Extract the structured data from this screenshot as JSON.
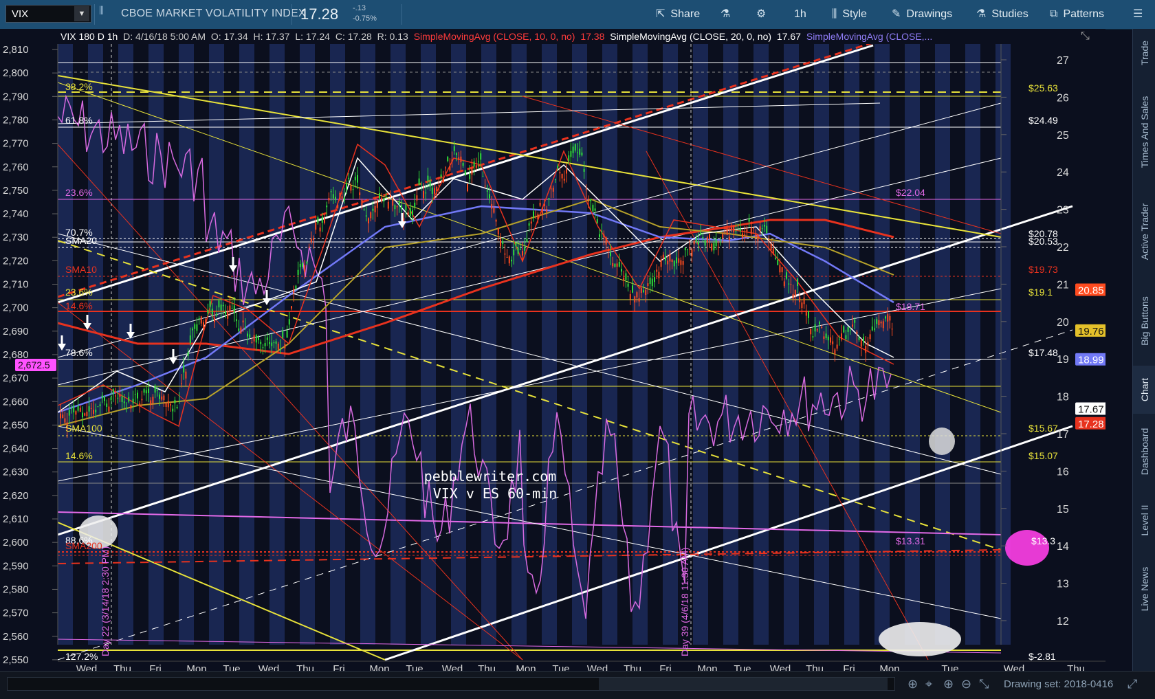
{
  "topbar": {
    "symbol": "VIX",
    "description": "CBOE MARKET VOLATILITY INDEX",
    "price": "17.28",
    "change": "-.13",
    "change_pct": "-0.75%",
    "share": "Share",
    "timeframe": "1h",
    "style": "Style",
    "drawings": "Drawings",
    "studies": "Studies",
    "patterns": "Patterns"
  },
  "info": {
    "symbol": "VIX 180 D 1h",
    "date": "D: 4/16/18 5:00 AM",
    "open": "O: 17.34",
    "high": "H: 17.37",
    "low": "L: 17.24",
    "close": "C: 17.28",
    "range": "R: 0.13",
    "sma10": "SimpleMovingAvg (CLOSE, 10, 0, no)",
    "sma10_val": "17.38",
    "sma20": "SimpleMovingAvg (CLOSE, 20, 0, no)",
    "sma20_val": "17.67",
    "sma_more": "SimpleMovingAvg (CLOSE,..."
  },
  "left_axis": [
    "2,810",
    "2,800",
    "2,790",
    "2,780",
    "2,770",
    "2,760",
    "2,750",
    "2,740",
    "2,730",
    "2,720",
    "2,710",
    "2,700",
    "2,690",
    "2,680",
    "2,670",
    "2,660",
    "2,650",
    "2,640",
    "2,630",
    "2,620",
    "2,610",
    "2,600",
    "2,590",
    "2,580",
    "2,570",
    "2,560",
    "2,550"
  ],
  "left_marker": "2,672.5",
  "right_axis": [
    "27",
    "26",
    "25",
    "24",
    "23",
    "22",
    "21",
    "20",
    "19",
    "18",
    "17",
    "16",
    "15",
    "14",
    "13",
    "12"
  ],
  "right_markers": {
    "sma10": "20.85",
    "sma50": "19.76",
    "sma100": "18.99",
    "sma20": "17.67",
    "last": "17.28"
  },
  "x_axis": [
    "Wed",
    "Thu",
    "Fri",
    "Mon",
    "Tue",
    "Wed",
    "Thu",
    "Fri",
    "Mon",
    "Tue",
    "Wed",
    "Thu",
    "Mon",
    "Tue",
    "Wed",
    "Thu",
    "Fri",
    "Mon",
    "Tue",
    "Wed",
    "Thu",
    "Fri",
    "Mon",
    "Tue",
    "Wed",
    "Thu"
  ],
  "fib_labels_left": [
    "38.2%",
    "61.8%",
    "23.6%",
    "70.7%",
    "SMA20",
    "SMA10",
    "23.6%",
    "14.6%",
    "78.6%",
    "SMA100",
    "14.6%",
    "88.6%",
    "SMA200",
    "127.2%"
  ],
  "level_labels_right": [
    "$25.63",
    "$24.49",
    "$22.04",
    "$20.78",
    "$20.53",
    "$19.73",
    "$19.1",
    "$18.71",
    "$17.48",
    "$15.67",
    "$15.07",
    "$13.31",
    "$13.3",
    "$-2.81"
  ],
  "watermark": {
    "line1": "pebblewriter.com",
    "line2": "VIX v ES 60-min"
  },
  "vertical_labels": {
    "day22": "Day 22 (3/14/18 2:30 PM)",
    "day39": "Day 39 (4/6/18 11:30 AM)"
  },
  "right_tabs": [
    "Trade",
    "Times And Sales",
    "Active Trader",
    "Big Buttons",
    "Chart",
    "Dashboard",
    "Level II",
    "Live News"
  ],
  "active_tab": "Chart",
  "bottom": {
    "drawing_set": "Drawing set: 2018-0416"
  },
  "colors": {
    "topbar": "#1d4e73",
    "background": "#0b0f1e",
    "band": "#1c2a5a",
    "red": "#e8321e",
    "yellow": "#e8e23a",
    "white": "#ffffff",
    "magenta": "#e36ae8",
    "blue": "#6a6ef0",
    "olive": "#b7a22a"
  }
}
